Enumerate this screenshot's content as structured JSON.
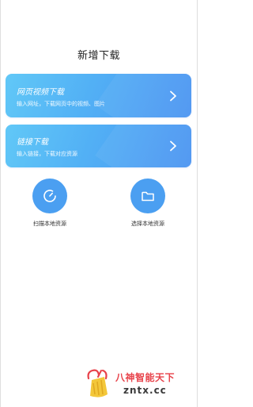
{
  "page": {
    "title": "新增下载"
  },
  "cards": {
    "web_video": {
      "title": "网页视频下载",
      "description": "输入网址，下载网页中的视频、图片",
      "icon": "chevron-right-icon"
    },
    "link": {
      "title": "链接下载",
      "description": "输入链接，下载对应资源",
      "icon": "chevron-right-icon"
    }
  },
  "actions": {
    "scan": {
      "label": "扫描本地资源",
      "icon": "scan-gauge-icon"
    },
    "local": {
      "label": "选择本地资源",
      "icon": "folder-icon"
    }
  },
  "watermark": {
    "title": "八神智能天下",
    "url": "zntx.cc",
    "icon": "broom-logo-icon"
  },
  "colors": {
    "card_gradient_start": "#61c8f7",
    "card_gradient_end": "#4a93f2",
    "circle_button": "#4b9ff1",
    "watermark_title": "#e8424a"
  }
}
